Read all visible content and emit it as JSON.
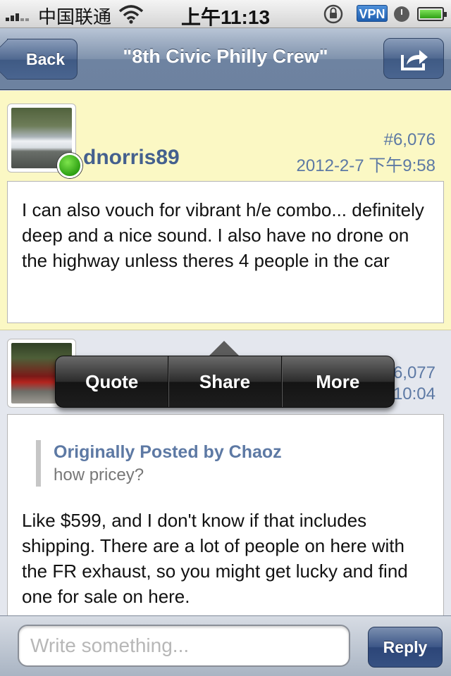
{
  "status_bar": {
    "carrier": "中国联通",
    "time": "上午11:13",
    "vpn_label": "VPN",
    "icons": [
      "signal-icon",
      "wifi-icon",
      "rotation-lock-icon",
      "vpn-icon",
      "clock-icon",
      "battery-icon"
    ]
  },
  "nav": {
    "back_label": "Back",
    "title": "\"8th Civic Philly Crew\"",
    "share_icon": "share-icon"
  },
  "posts": [
    {
      "username": "dnorris89",
      "post_number": "#6,076",
      "date": "2012-2-7 下午9:58",
      "online": true,
      "body": "I can also vouch for vibrant h/e combo... definitely deep and a nice sound. I also have no drone on the highway unless theres 4 people in the car"
    },
    {
      "post_number_partial": "6,077",
      "date_partial": "10:04",
      "quote": {
        "author": "Originally Posted by Chaoz",
        "text": "how pricey?"
      },
      "body": "Like $599, and I don't know if that includes shipping. There are a lot of people on here with the FR exhaust, so you might get lucky and find one for sale on here."
    }
  ],
  "popup_menu": {
    "items": [
      "Quote",
      "Share",
      "More"
    ]
  },
  "bottom_bar": {
    "input_placeholder": "Write something...",
    "input_value": "",
    "reply_label": "Reply"
  },
  "colors": {
    "highlight_post_bg": "#fbf8c4",
    "link_blue": "#5d79a4",
    "online_green": "#2ea013",
    "nav_blue": "#6e83a1"
  }
}
